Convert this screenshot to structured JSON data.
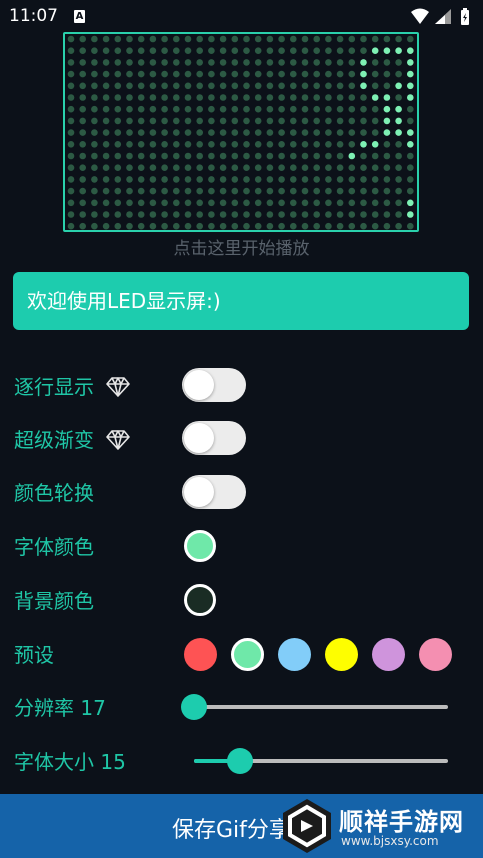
{
  "status_bar": {
    "time": "11:07",
    "notification_icon": "a-notification-icon",
    "icons": [
      "wifi-icon",
      "signal-icon",
      "battery-icon"
    ]
  },
  "led_display": {
    "border_color": "#2ad1ac",
    "lit_color": "#7ef0b4",
    "dim_color": "#2c5a44",
    "visible_glyph": "9"
  },
  "hint": "点击这里开始播放",
  "text_input": {
    "value": "欢迎使用LED显示屏:)"
  },
  "settings": {
    "line_by_line": {
      "label": "逐行显示",
      "premium_icon": "diamond-icon",
      "on": false
    },
    "super_gradient": {
      "label": "超级渐变",
      "premium_icon": "diamond-icon",
      "on": false
    },
    "color_rotation": {
      "label": "颜色轮换",
      "on": false
    },
    "font_color": {
      "label": "字体颜色",
      "color": "#6fe8a9"
    },
    "background_color": {
      "label": "背景颜色",
      "color": "#1a2c24"
    },
    "presets": {
      "label": "预设",
      "colors": [
        "#fe5354",
        "#6fe8a9",
        "#82cdf9",
        "#fefe00",
        "#cf94dc",
        "#f48fb1"
      ],
      "selected_index": 1
    },
    "resolution": {
      "label": "分辨率 17",
      "fraction": 0.0
    },
    "font_size": {
      "label": "字体大小 15",
      "fraction": 0.18
    }
  },
  "bottom_button": {
    "label": "保存Gif分享"
  },
  "watermark": {
    "title": "顺祥手游网",
    "url": "www.bjsxsy.com"
  }
}
